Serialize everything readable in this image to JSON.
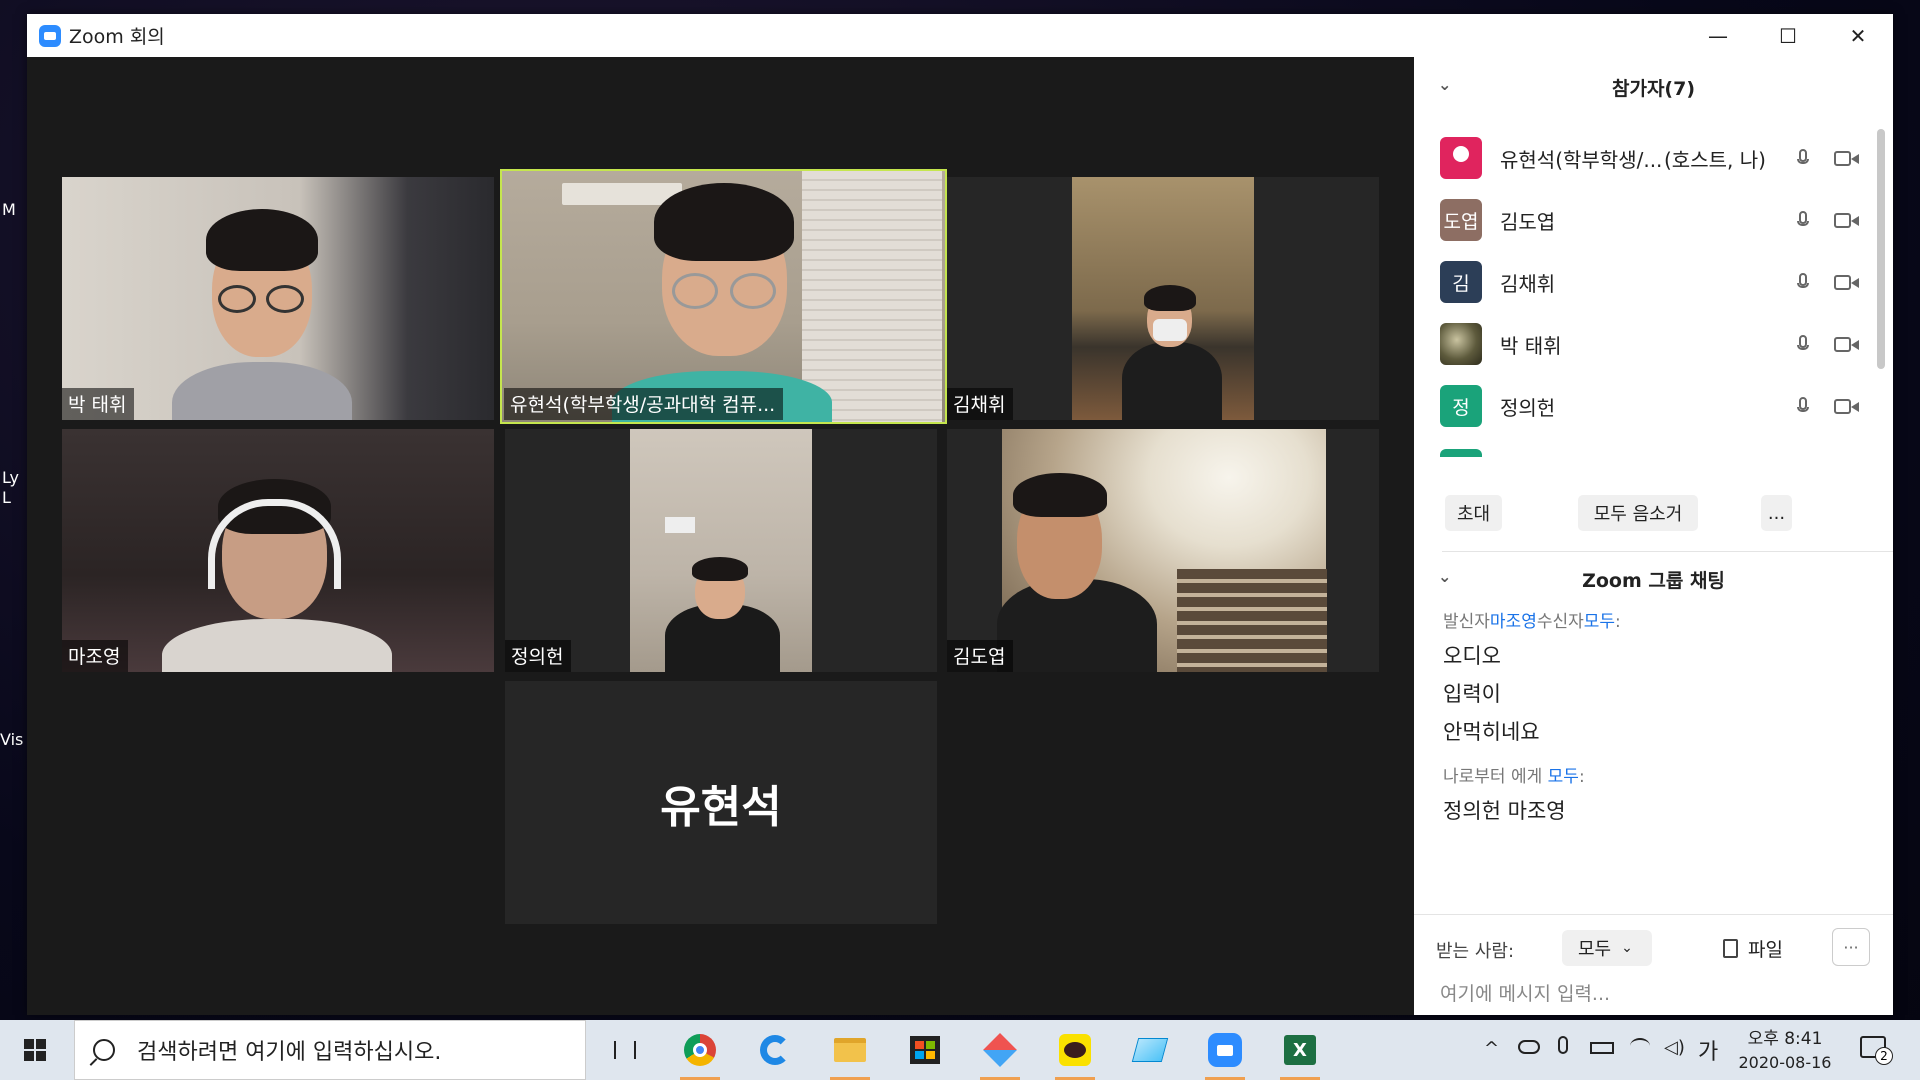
{
  "window": {
    "title": "Zoom 회의",
    "minimize": "—",
    "maximize": "☐",
    "close": "✕"
  },
  "desktop": {
    "left_labels": [
      "M",
      "Ly",
      "L",
      "Vis"
    ]
  },
  "videos": [
    {
      "name": "박 태휘",
      "active": false
    },
    {
      "name": "유현석(학부학생/공과대학 컴퓨...",
      "active": true
    },
    {
      "name": "김채휘",
      "active": false
    },
    {
      "name": "마조영",
      "active": false
    },
    {
      "name": "정의헌",
      "active": false
    },
    {
      "name": "김도엽",
      "active": false
    },
    {
      "name": "유현석",
      "active": false
    }
  ],
  "participants": {
    "header": "참가자(7)",
    "rows": [
      {
        "avatar_text": "",
        "avatar_color": "#e0245e",
        "name": "유현석(학부학생/...",
        "tag": "(호스트, 나)"
      },
      {
        "avatar_text": "도엽",
        "avatar_color": "#8d6e63",
        "name": "김도엽",
        "tag": ""
      },
      {
        "avatar_text": "김",
        "avatar_color": "#2c3e57",
        "name": "김채휘",
        "tag": ""
      },
      {
        "avatar_text": "",
        "avatar_color": "#5d5a3c",
        "name": "박 태휘",
        "tag": ""
      },
      {
        "avatar_text": "정",
        "avatar_color": "#1aa37a",
        "name": "정의헌",
        "tag": ""
      }
    ],
    "buttons": {
      "invite": "초대",
      "mute_all": "모두 음소거",
      "more": "..."
    }
  },
  "chat": {
    "header": "Zoom 그룹 채팅",
    "groups": [
      {
        "meta_prefix": "발신자",
        "sender": "마조영",
        "meta_mid": "수신자",
        "recipient": "모두",
        "meta_suffix": ":",
        "messages": [
          "오디오",
          "입력이",
          "안먹히네요"
        ]
      },
      {
        "meta_prefix": "나로부터 에게 ",
        "sender": "",
        "meta_mid": "",
        "recipient": "모두",
        "meta_suffix": ":",
        "messages": [
          "정의헌 마조영"
        ]
      }
    ],
    "to_label": "받는 사람:",
    "to_value": "모두",
    "file_label": "파일",
    "more": "···",
    "input_placeholder": "여기에 메시지 입력..."
  },
  "taskbar": {
    "search_placeholder": "검색하려면 여기에 입력하십시오.",
    "ime": "가",
    "time": "오후 8:41",
    "date": "2020-08-16",
    "notifications": "2"
  }
}
